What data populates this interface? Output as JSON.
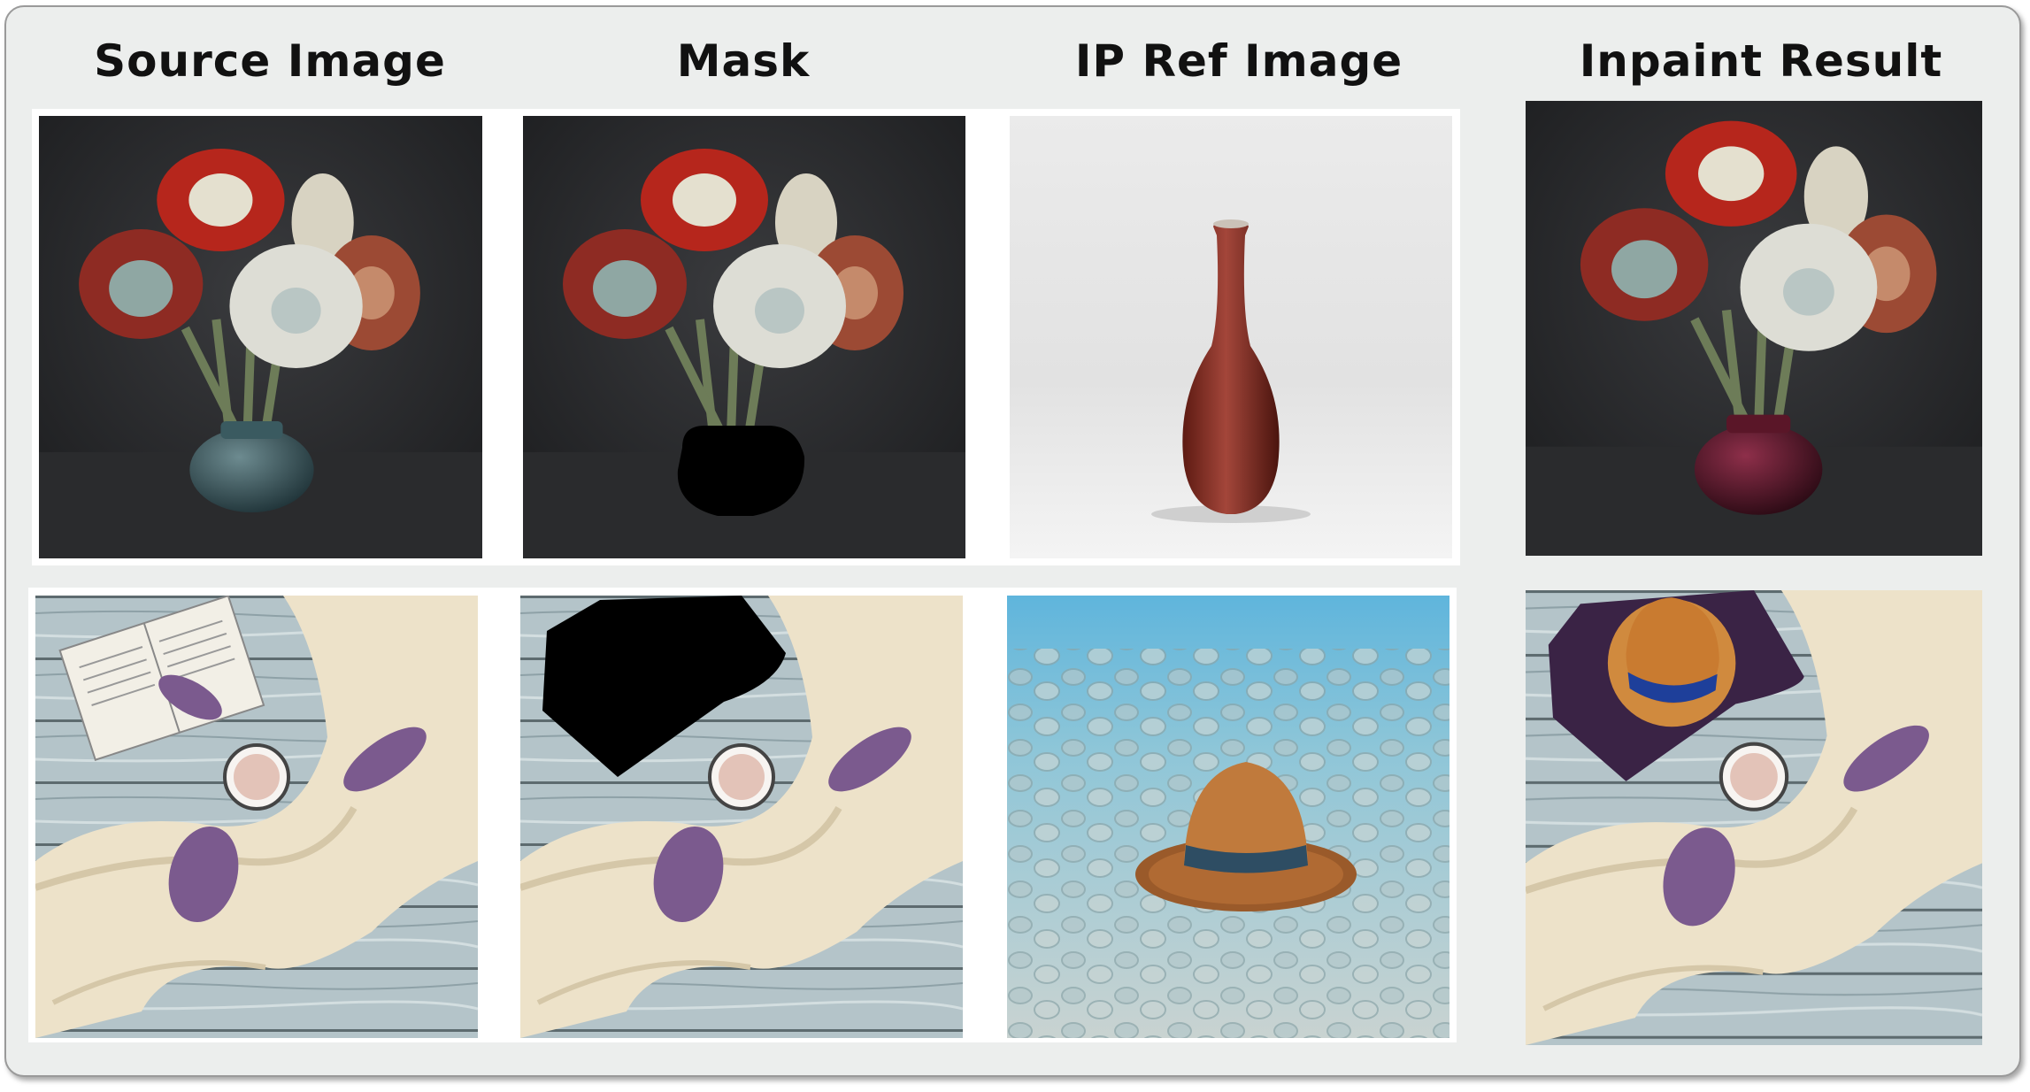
{
  "headers": {
    "source": "Source Image",
    "mask": "Mask",
    "ip_ref": "IP Ref Image",
    "result": "Inpaint Result"
  },
  "colors": {
    "panel_bg": "#eceeed",
    "dark_background": "#2b2c2f",
    "mask_black": "#000000",
    "wood_blue_gray": "#a9bcc3",
    "scarf_cream": "#ece1c8",
    "lilac": "#7b5a8e",
    "straw_hat": "#c07a3c",
    "water_blue": "#5fb5dc"
  },
  "rows": [
    {
      "source": "flowers-in-teal-vase",
      "mask": "flowers-with-vase-masked",
      "ip_ref": "red-ceramic-vase",
      "result": "flowers-in-red-vase"
    },
    {
      "source": "book-cup-scarf-on-wood",
      "mask": "book-area-masked",
      "ip_ref": "straw-hat-in-water",
      "result": "straw-hat-on-cloth"
    }
  ]
}
